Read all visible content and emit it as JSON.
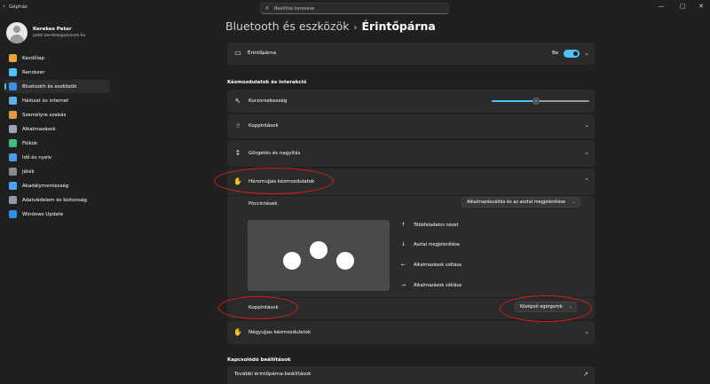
{
  "app": {
    "title": "Gépház",
    "search_placeholder": "Beállítás keresése"
  },
  "window_controls": {
    "minimize": "—",
    "maximize": "▢",
    "close": "✕"
  },
  "profile": {
    "name": "Kerekes Peter",
    "email": "peter.kerekes@alvicom.hu"
  },
  "nav": {
    "items": [
      {
        "label": "Kezdőlap",
        "icon": "home-icon",
        "color": "#e8a33b"
      },
      {
        "label": "Rendszer",
        "icon": "monitor-icon",
        "color": "#4cc2ff"
      },
      {
        "label": "Bluetooth és eszközök",
        "icon": "bluetooth-icon",
        "color": "#3b8eea",
        "active": true
      },
      {
        "label": "Hálózat és internet",
        "icon": "wifi-icon",
        "color": "#5db2e8"
      },
      {
        "label": "Személyre szabás",
        "icon": "brush-icon",
        "color": "#e0974a"
      },
      {
        "label": "Alkalmazások",
        "icon": "apps-icon",
        "color": "#9aa6b8"
      },
      {
        "label": "Fiókok",
        "icon": "person-icon",
        "color": "#3fbf7f"
      },
      {
        "label": "Idő és nyelv",
        "icon": "globe-clock-icon",
        "color": "#4f9de8"
      },
      {
        "label": "Játék",
        "icon": "gamepad-icon",
        "color": "#8a8a8a"
      },
      {
        "label": "Akadálymentesség",
        "icon": "accessibility-icon",
        "color": "#4aa3ff"
      },
      {
        "label": "Adatvédelem és biztonság",
        "icon": "shield-icon",
        "color": "#8e9aa8"
      },
      {
        "label": "Windows Update",
        "icon": "update-icon",
        "color": "#2f8fe8"
      }
    ]
  },
  "breadcrumb": {
    "parent": "Bluetooth és eszközök",
    "separator": "›",
    "current": "Érintőpárna"
  },
  "touchpad_card": {
    "label": "Érintőpárna",
    "toggle_label": "Be",
    "toggle_on": true
  },
  "gestures_section": {
    "title": "Kézmozdulatok és interakció",
    "cursor_speed_label": "Kurzorsebesség",
    "cursor_speed_value": 0.45,
    "taps_label": "Koppintások",
    "scroll_zoom_label": "Görgetés és nagyítás",
    "three_finger": {
      "label": "Háromujjas kézmozdulatok",
      "swipes_label": "Pöccintések",
      "swipes_value": "Alkalmazásváltás és az asztal megjelenítése",
      "gestures": [
        {
          "arrow": "↑",
          "label": "Többfeladatos nézet"
        },
        {
          "arrow": "↓",
          "label": "Asztal megjelenítése"
        },
        {
          "arrow": "←",
          "label": "Alkalmazások váltása"
        },
        {
          "arrow": "→",
          "label": "Alkalmazások váltása"
        }
      ],
      "taps_label": "Koppintások",
      "taps_value": "Középső egérgomb"
    },
    "four_finger_label": "Négyujjas kézmozdulatok"
  },
  "related_section": {
    "title": "Kapcsolódó beállítások",
    "more_settings_label": "További érintőpárna-beállítások"
  },
  "colors": {
    "accent": "#4cc2ff",
    "annotation": "#d81e1e"
  }
}
